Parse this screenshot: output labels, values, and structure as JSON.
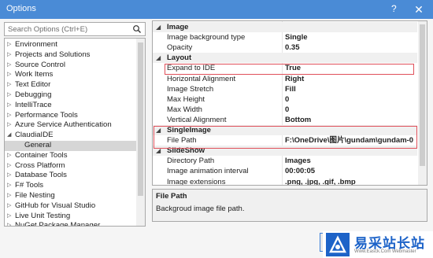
{
  "window": {
    "title": "Options",
    "help": "?",
    "close": "✕"
  },
  "search": {
    "placeholder": "Search Options (Ctrl+E)"
  },
  "tree": [
    {
      "label": "Environment",
      "arrow": "▷"
    },
    {
      "label": "Projects and Solutions",
      "arrow": "▷"
    },
    {
      "label": "Source Control",
      "arrow": "▷"
    },
    {
      "label": "Work Items",
      "arrow": "▷"
    },
    {
      "label": "Text Editor",
      "arrow": "▷"
    },
    {
      "label": "Debugging",
      "arrow": "▷"
    },
    {
      "label": "IntelliTrace",
      "arrow": "▷"
    },
    {
      "label": "Performance Tools",
      "arrow": "▷"
    },
    {
      "label": "Azure Service Authentication",
      "arrow": "▷"
    },
    {
      "label": "ClaudiaIDE",
      "arrow": "◢"
    },
    {
      "label": "General",
      "arrow": "",
      "child": true,
      "selected": true
    },
    {
      "label": "Container Tools",
      "arrow": "▷"
    },
    {
      "label": "Cross Platform",
      "arrow": "▷"
    },
    {
      "label": "Database Tools",
      "arrow": "▷"
    },
    {
      "label": "F# Tools",
      "arrow": "▷"
    },
    {
      "label": "File Nesting",
      "arrow": "▷"
    },
    {
      "label": "GitHub for Visual Studio",
      "arrow": "▷"
    },
    {
      "label": "Live Unit Testing",
      "arrow": "▷"
    },
    {
      "label": "NuGet Package Manager",
      "arrow": "▷"
    }
  ],
  "grid": [
    {
      "cat": true,
      "label": "Image"
    },
    {
      "name": "Image background type",
      "value": "Single"
    },
    {
      "name": "Opacity",
      "value": "0.35"
    },
    {
      "cat": true,
      "label": "Layout"
    },
    {
      "name": "Expand to IDE",
      "value": "True"
    },
    {
      "name": "Horizontal Alignment",
      "value": "Right"
    },
    {
      "name": "Image Stretch",
      "value": "Fill"
    },
    {
      "name": "Max Height",
      "value": "0"
    },
    {
      "name": "Max Width",
      "value": "0"
    },
    {
      "name": "Vertical Alignment",
      "value": "Bottom"
    },
    {
      "cat": true,
      "label": "SingleImage"
    },
    {
      "name": "File Path",
      "value": "F:\\OneDrive\\图片\\gundam\\gundam-0"
    },
    {
      "cat": true,
      "label": "SlideShow"
    },
    {
      "name": "Directory Path",
      "value": "Images"
    },
    {
      "name": "Image animation interval",
      "value": "00:00:05"
    },
    {
      "name": "Image extensions",
      "value": ".png, .jpg, .gif, .bmp"
    }
  ],
  "description": {
    "title": "File Path",
    "text": "Backgroud image file path."
  },
  "watermark": {
    "cn": "易采站长站",
    "en": "Www.Easck.Com Webmaster"
  },
  "colors": {
    "titlebar": "#4a8bd6",
    "highlight": "#e0505a",
    "brand": "#1d63c8"
  }
}
